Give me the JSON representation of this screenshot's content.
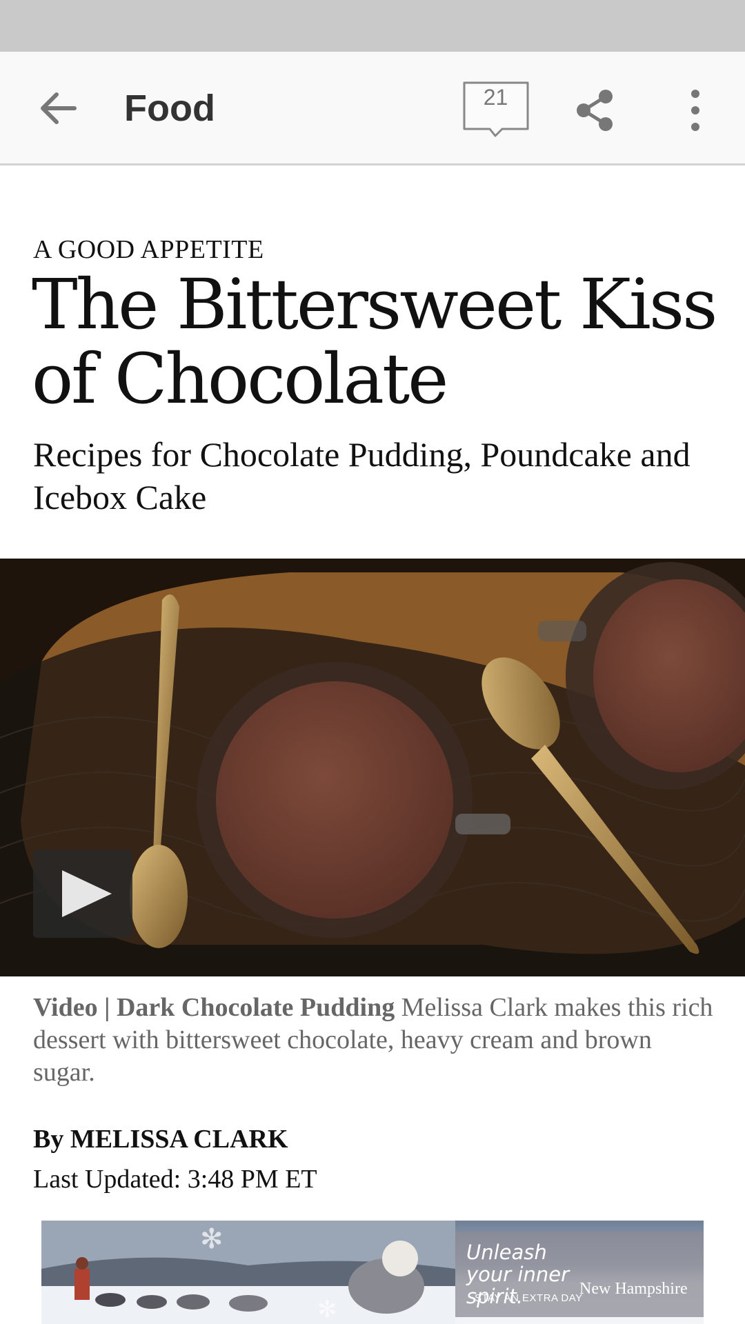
{
  "app_bar": {
    "title": "Food",
    "comment_count": "21",
    "icons": {
      "back": "arrow-back-icon",
      "comments": "comment-bubble-icon",
      "share": "share-icon",
      "more": "more-vert-icon"
    }
  },
  "article": {
    "kicker": "A GOOD APPETITE",
    "headline": "The Bittersweet Kiss of Chocolate",
    "subhead": "Recipes for Chocolate Pudding, Poundcake and Icebox Cake",
    "media": {
      "caption_label": "Video | Dark Chocolate Pudding",
      "caption_text": "Melissa Clark makes this rich dessert with bittersweet chocolate, heavy cream and brown sugar."
    },
    "byline": "By MELISSA CLARK",
    "updated": "Last Updated: 3:48 PM ET"
  },
  "ad": {
    "headline": "Unleash your inner spirit.",
    "tagline": "STAY AN EXTRA DAY",
    "brand": "New Hampshire"
  },
  "colors": {
    "status_bar": "#c9c9c9",
    "app_bar": "#f9f9f9",
    "icon_gray": "#777777",
    "caption_gray": "#666666"
  }
}
